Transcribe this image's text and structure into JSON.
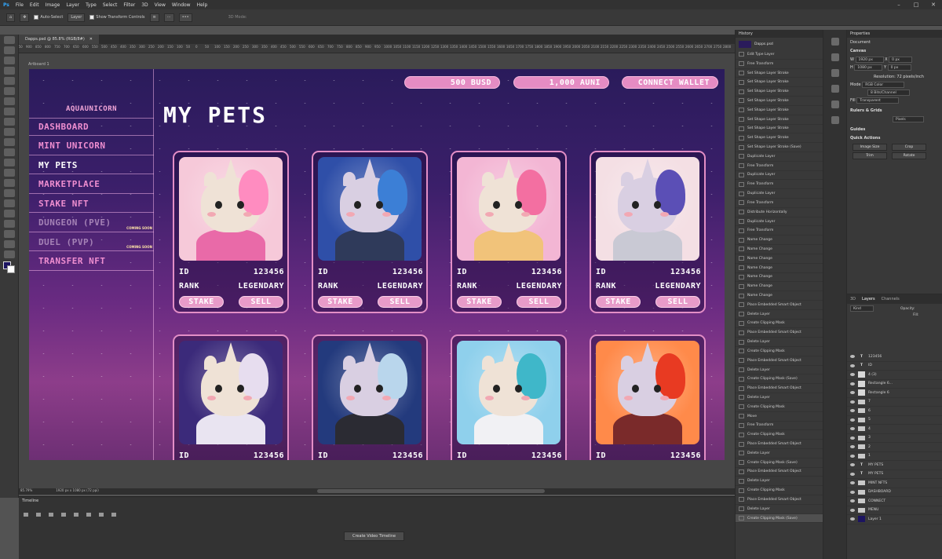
{
  "app": {
    "menu": [
      "File",
      "Edit",
      "Image",
      "Layer",
      "Type",
      "Select",
      "Filter",
      "3D",
      "View",
      "Window",
      "Help"
    ],
    "logo": "Ps"
  },
  "options": {
    "auto_select": "Auto-Select",
    "layer_select": "Layer",
    "show_transform": "Show Transform Controls",
    "mode_3d": "3D Mode:"
  },
  "doc": {
    "tab_title": "Dapps.psd @ 85.8% (RGB/8#)",
    "artboard_label": "Artboard 1",
    "zoom": "85.79%",
    "size": "1920 px x 1080 px (72 ppi)"
  },
  "ruler": [
    "950",
    "900",
    "850",
    "800",
    "750",
    "700",
    "650",
    "600",
    "550",
    "500",
    "450",
    "400",
    "350",
    "300",
    "250",
    "200",
    "150",
    "100",
    "50",
    "0",
    "50",
    "100",
    "150",
    "200",
    "250",
    "300",
    "350",
    "400",
    "450",
    "500",
    "550",
    "600",
    "650",
    "700",
    "750",
    "800",
    "850",
    "900",
    "950",
    "1000",
    "1050",
    "1100",
    "1150",
    "1200",
    "1250",
    "1300",
    "1350",
    "1400",
    "1450",
    "1500",
    "1550",
    "1600",
    "1650",
    "1700",
    "1750",
    "1800",
    "1850",
    "1900",
    "1950",
    "2000",
    "2050",
    "2100",
    "2150",
    "2200",
    "2250",
    "2300",
    "2350",
    "2400",
    "2450",
    "2500",
    "2550",
    "2600",
    "2650",
    "2700",
    "2750",
    "2800"
  ],
  "site": {
    "brand": "AQUAUNICORN",
    "title": "MY PETS",
    "balances": {
      "busd": "500 BUSD",
      "auni": "1,000 AUNI",
      "connect": "CONNECT WALLET"
    },
    "nav": [
      {
        "label": "DASHBOARD",
        "state": "normal",
        "soon": ""
      },
      {
        "label": "MINT UNICORN",
        "state": "normal",
        "soon": ""
      },
      {
        "label": "MY PETS",
        "state": "active",
        "soon": ""
      },
      {
        "label": "MARKETPLACE",
        "state": "normal",
        "soon": ""
      },
      {
        "label": "STAKE NFT",
        "state": "normal",
        "soon": ""
      },
      {
        "label": "DUNGEON (PVE)",
        "state": "dim",
        "soon": "COMING SOON"
      },
      {
        "label": "DUEL (PVP)",
        "state": "dim",
        "soon": "COMING SOON"
      },
      {
        "label": "TRANSFER NFT",
        "state": "normal",
        "soon": ""
      }
    ],
    "labels": {
      "id": "ID",
      "rank": "RANK",
      "stake": "STAKE",
      "sell": "SELL"
    },
    "pets": [
      {
        "id": "123456",
        "rank": "LEGENDARY",
        "bg": "#f6c9d9",
        "mane": "#ff8cc0",
        "body": "#e96aa8"
      },
      {
        "id": "123456",
        "rank": "LEGENDARY",
        "bg": "#2f4fa8",
        "mane": "#3c7fd6",
        "body": "#2f3a5a"
      },
      {
        "id": "123456",
        "rank": "LEGENDARY",
        "bg": "#f3b6d4",
        "mane": "#f36fa1",
        "body": "#f1c37a"
      },
      {
        "id": "123456",
        "rank": "LEGENDARY",
        "bg": "#f4dfe4",
        "mane": "#5b4fb6",
        "body": "#c9c9d4"
      },
      {
        "id": "123456",
        "rank": "",
        "bg": "#3b2a7a",
        "mane": "#e7ddef",
        "body": "#e9e4f1"
      },
      {
        "id": "123456",
        "rank": "",
        "bg": "#233a7d",
        "mane": "#b9d6ec",
        "body": "#2b2b33"
      },
      {
        "id": "123456",
        "rank": "",
        "bg": "#8fd0ec",
        "mane": "#3fb7c9",
        "body": "#f1f1f4"
      },
      {
        "id": "123456",
        "rank": "",
        "bg": "#ff8a4a",
        "mane": "#e83a22",
        "body": "#7a2a2a"
      }
    ]
  },
  "history": {
    "title": "History",
    "snapshot": "Dapps.psd",
    "items": [
      "Edit Type Layer",
      "Free Transform",
      "Set Shape Layer Stroke",
      "Set Shape Layer Stroke",
      "Set Shape Layer Stroke",
      "Set Shape Layer Stroke",
      "Set Shape Layer Stroke",
      "Set Shape Layer Stroke",
      "Set Shape Layer Stroke",
      "Set Shape Layer Stroke",
      "Set Shape Layer Stroke (Save)",
      "Duplicate Layer",
      "Free Transform",
      "Duplicate Layer",
      "Free Transform",
      "Duplicate Layer",
      "Free Transform",
      "Distribute Horizontally",
      "Duplicate Layer",
      "Free Transform",
      "Name Change",
      "Name Change",
      "Name Change",
      "Name Change",
      "Name Change",
      "Name Change",
      "Name Change",
      "Place Embedded Smart Object",
      "Delete Layer",
      "Create Clipping Mask",
      "Place Embedded Smart Object",
      "Delete Layer",
      "Create Clipping Mask",
      "Place Embedded Smart Object",
      "Delete Layer",
      "Create Clipping Mask (Save)",
      "Place Embedded Smart Object",
      "Delete Layer",
      "Create Clipping Mask",
      "Move",
      "Free Transform",
      "Create Clipping Mask",
      "Place Embedded Smart Object",
      "Delete Layer",
      "Create Clipping Mask (Save)",
      "Place Embedded Smart Object",
      "Delete Layer",
      "Create Clipping Mask",
      "Place Embedded Smart Object",
      "Delete Layer",
      "Create Clipping Mask (Save)"
    ]
  },
  "properties": {
    "title": "Properties",
    "doc": "Document",
    "canvas": "Canvas",
    "w": "1920 px",
    "h": "1080 px",
    "x": "0 px",
    "y": "0 px",
    "resolution": "Resolution: 72 pixels/inch",
    "mode_label": "Mode",
    "mode": "RGB Color",
    "bits": "8 Bits/Channel",
    "fill_label": "Fill",
    "fill": "Transparent",
    "rulers": "Rulers & Grids",
    "units": "Pixels",
    "guides": "Guides",
    "quick": "Quick Actions",
    "image_size": "Image Size",
    "crop": "Crop",
    "trim": "Trim",
    "rotate": "Rotate"
  },
  "layers": {
    "tabs": [
      "3D",
      "Layers",
      "Channels"
    ],
    "kind": "Kind",
    "opacity": "Opacity:",
    "fill": "Fill:",
    "items": [
      {
        "t": "text",
        "name": "123456"
      },
      {
        "t": "text",
        "name": "ID"
      },
      {
        "t": "img",
        "name": "4 (3)"
      },
      {
        "t": "img",
        "name": "Rectangle 6..."
      },
      {
        "t": "img",
        "name": "Rectangle 6"
      },
      {
        "t": "folder",
        "name": "7"
      },
      {
        "t": "folder",
        "name": "6"
      },
      {
        "t": "folder",
        "name": "5"
      },
      {
        "t": "folder",
        "name": "4"
      },
      {
        "t": "folder",
        "name": "3"
      },
      {
        "t": "folder",
        "name": "2"
      },
      {
        "t": "folder",
        "name": "1"
      },
      {
        "t": "text",
        "name": "MY PETS"
      },
      {
        "t": "text",
        "name": "MY PETS"
      },
      {
        "t": "folder",
        "name": "MINT NFTS"
      },
      {
        "t": "folder",
        "name": "DASHBOARD"
      },
      {
        "t": "folder",
        "name": "CONNECT"
      },
      {
        "t": "folder",
        "name": "MENU"
      },
      {
        "t": "img",
        "name": "Layer 1"
      }
    ]
  },
  "timeline": {
    "title": "Timeline",
    "create": "Create Video Timeline"
  }
}
